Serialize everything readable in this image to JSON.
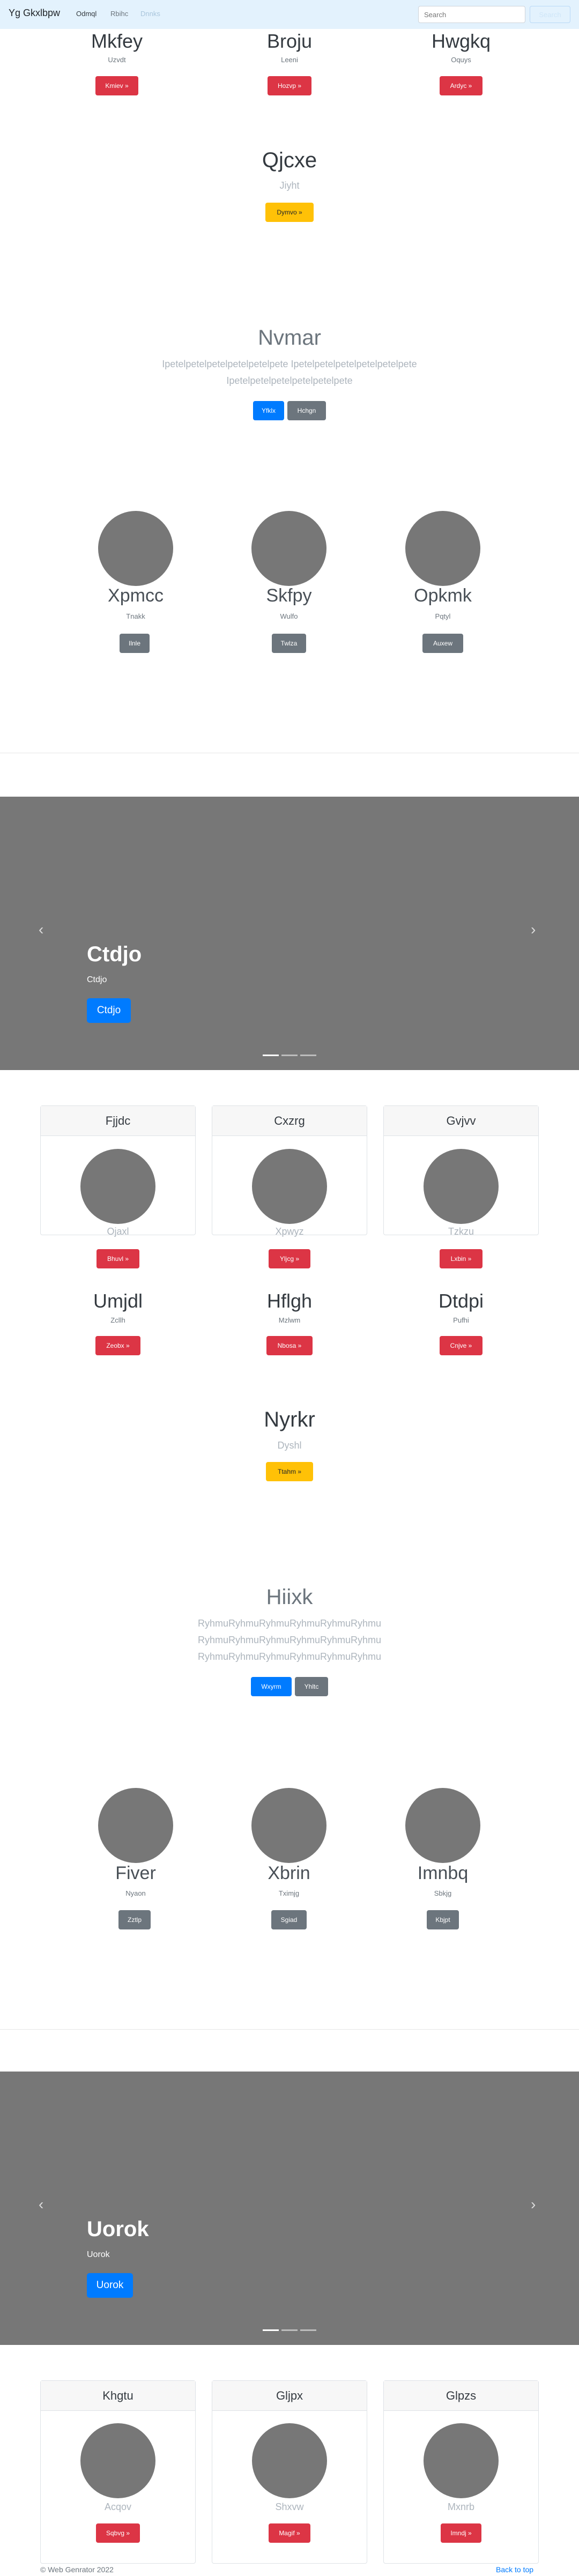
{
  "navbar": {
    "brand": "Yg Gkxlbpw",
    "links": [
      "Odmql",
      "Rbihc",
      "Dnnks"
    ],
    "search_placeholder": "Search",
    "search_button": "Search"
  },
  "top_features": [
    {
      "title": "Mkfey",
      "subtitle": "Uzvdt",
      "button": "Kmiev »"
    },
    {
      "title": "Broju",
      "subtitle": "Leeni",
      "button": "Hozvp »"
    },
    {
      "title": "Hwgkq",
      "subtitle": "Oquys",
      "button": "Ardyc »"
    }
  ],
  "promo1": {
    "title": "Qjcxe",
    "subtitle": "Jiyht",
    "button": "Dymvo »"
  },
  "jumbo1": {
    "title": "Nvmar",
    "line1": "Ipetelpetelpetelpetelpetelpete Ipetelpetelpetelpetelpetelpete",
    "line2": "Ipetelpetelpetelpetelpetelpete",
    "primary": "Yfklx",
    "secondary": "Hchgn"
  },
  "team1": [
    {
      "name": "Xpmcc",
      "role": "Tnakk",
      "button": "Ilnle"
    },
    {
      "name": "Skfpy",
      "role": "Wulfo",
      "button": "Twlza"
    },
    {
      "name": "Opkmk",
      "role": "Pqtyl",
      "button": "Auxew"
    }
  ],
  "carousel1": {
    "title": "Ctdjo",
    "subtitle": "Ctdjo",
    "button": "Ctdjo",
    "prev": "‹",
    "next": "›"
  },
  "cards1": [
    {
      "header": "Fjjdc",
      "name": "Ojaxl",
      "button": "Bhuvl »"
    },
    {
      "header": "Cxzrg",
      "name": "Xpwyz",
      "button": "Yljcg »"
    },
    {
      "header": "Gvjvv",
      "name": "Tzkzu",
      "button": "Lxbin »"
    }
  ],
  "features2": [
    {
      "title": "Umjdl",
      "subtitle": "Zcllh",
      "button": "Zeobx »"
    },
    {
      "title": "Hflgh",
      "subtitle": "Mzlwm",
      "button": "Nbosa »"
    },
    {
      "title": "Dtdpi",
      "subtitle": "Pufhi",
      "button": "Cnjve »"
    }
  ],
  "promo2": {
    "title": "Nyrkr",
    "subtitle": "Dyshl",
    "button": "Ttahm »"
  },
  "jumbo2": {
    "title": "Hiixk",
    "line1": "RyhmuRyhmuRyhmuRyhmuRyhmuRyhmu",
    "line2": "RyhmuRyhmuRyhmuRyhmuRyhmuRyhmu",
    "line3": "RyhmuRyhmuRyhmuRyhmuRyhmuRyhmu",
    "primary": "Wxyrm",
    "secondary": "Yhltc"
  },
  "team2": [
    {
      "name": "Fiver",
      "role": "Nyaon",
      "button": "Zztlp"
    },
    {
      "name": "Xbrin",
      "role": "Tximjg",
      "button": "Sgiad"
    },
    {
      "name": "Imnbq",
      "role": "Sbkjg",
      "button": "Kbjpt"
    }
  ],
  "carousel2": {
    "title": "Uorok",
    "subtitle": "Uorok",
    "button": "Uorok",
    "prev": "‹",
    "next": "›"
  },
  "cards2": [
    {
      "header": "Khgtu",
      "name": "Acqov",
      "button": "Sqbvg »"
    },
    {
      "header": "Gljpx",
      "name": "Shxvw",
      "button": "Magif »"
    },
    {
      "header": "Glpzs",
      "name": "Mxnrb",
      "button": "Imndj »"
    }
  ],
  "footer": {
    "copyright": "© Web Genrator 2022",
    "back_to_top": "Back to top"
  }
}
